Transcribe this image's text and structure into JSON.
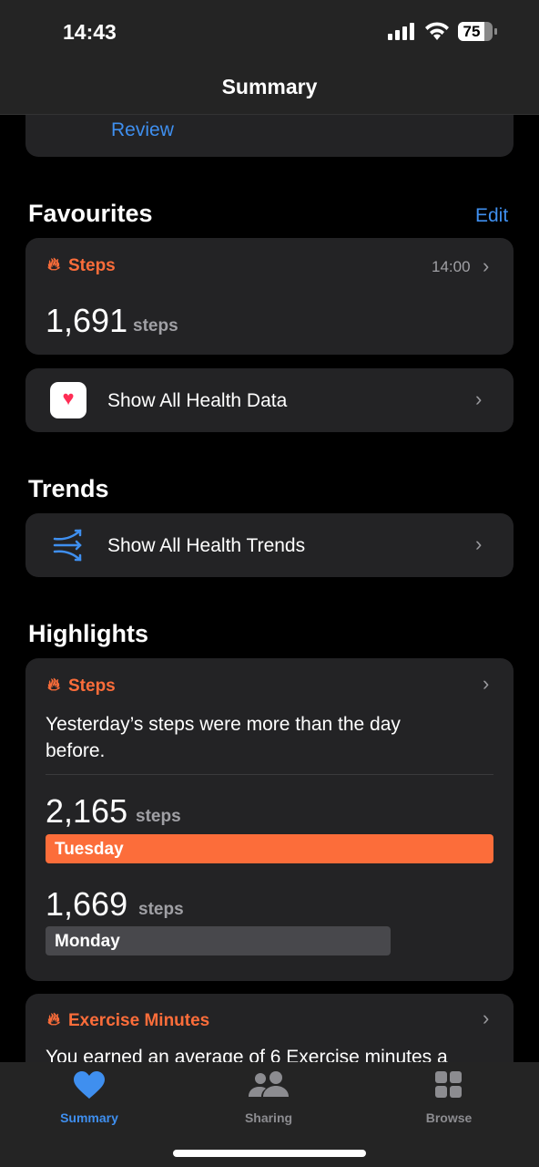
{
  "status_bar": {
    "time": "14:43",
    "battery": "75"
  },
  "header": {
    "title": "Summary"
  },
  "top_card": {
    "link": "Review"
  },
  "favourites": {
    "title": "Favourites",
    "edit": "Edit",
    "steps": {
      "label": "Steps",
      "time": "14:00",
      "value": "1,691",
      "unit": "steps"
    },
    "show_all": "Show All Health Data"
  },
  "trends": {
    "title": "Trends",
    "show_all": "Show All Health Trends"
  },
  "highlights": {
    "title": "Highlights",
    "steps": {
      "label": "Steps",
      "text": "Yesterday’s steps were more than the day before.",
      "rows": [
        {
          "value": "2,165",
          "unit": "steps",
          "day": "Tuesday",
          "fraction": 1.0
        },
        {
          "value": "1,669",
          "unit": "steps",
          "day": "Monday",
          "fraction": 0.771
        }
      ]
    },
    "exercise": {
      "label": "Exercise Minutes",
      "text": "You earned an average of 6 Exercise minutes a"
    }
  },
  "tabs": [
    {
      "label": "Summary",
      "icon": "heart-icon",
      "active": true
    },
    {
      "label": "Sharing",
      "icon": "people-icon"
    },
    {
      "label": "Browse",
      "icon": "grid-icon"
    }
  ],
  "colors": {
    "accent": "#3f8fef",
    "steps": "#fc6d3a",
    "card": "#232325"
  }
}
